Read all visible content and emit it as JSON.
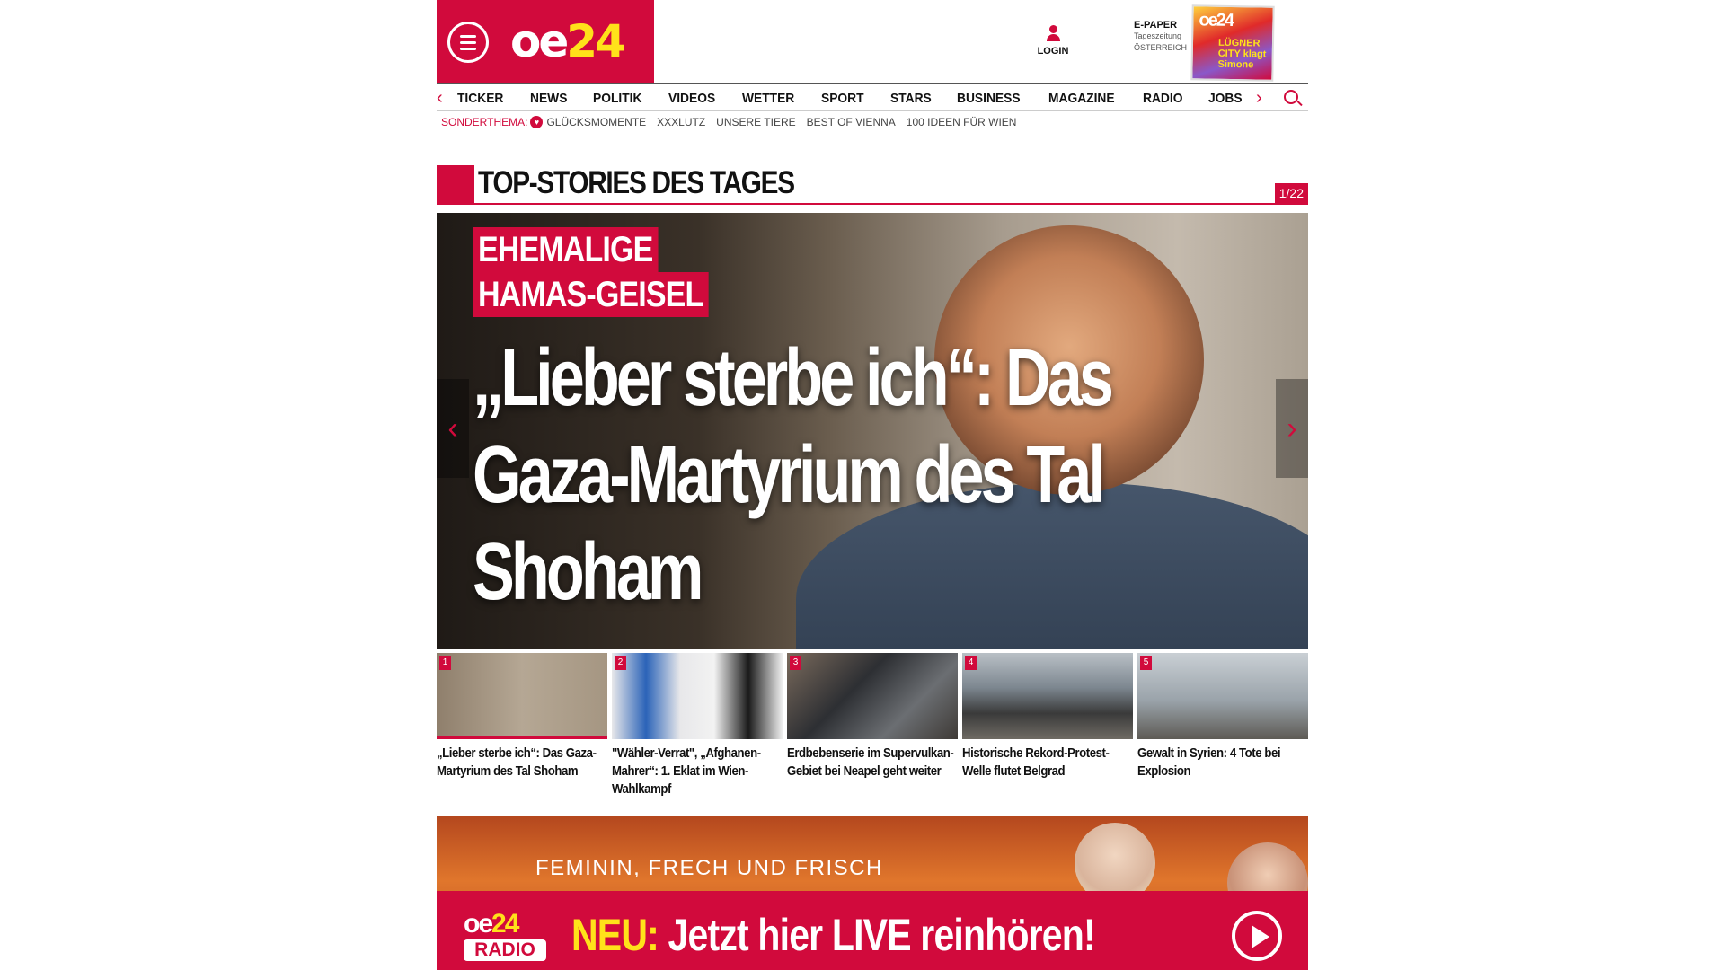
{
  "header": {
    "logo": {
      "part1": "oe",
      "part2": "24"
    },
    "login_label": "LOGIN",
    "epaper": {
      "title": "E-PAPER",
      "line2": "Tageszeitung",
      "line3": "ÖSTERREICH",
      "cover_logo": "oe24",
      "cover_text": "LÜGNER CITY klagt Simone"
    }
  },
  "nav": {
    "items": [
      "TICKER",
      "NEWS",
      "POLITIK",
      "VIDEOS",
      "WETTER",
      "SPORT",
      "STARS",
      "BUSINESS",
      "MAGAZINE",
      "RADIO",
      "JOBS"
    ]
  },
  "subnav": {
    "label": "SONDERTHEMA:",
    "items": [
      "GLÜCKSMOMENTE",
      "XXXLUTZ",
      "UNSERE TIERE",
      "BEST OF VIENNA",
      "100 IDEEN FÜR WIEN"
    ]
  },
  "top_stories": {
    "title": "TOP-STORIES DES TAGES",
    "counter": "1/22"
  },
  "hero": {
    "kicker_line1": "EHEMALIGE",
    "kicker_line2": "HAMAS-GEISEL",
    "headline": "„Lieber sterbe ich“: Das Gaza-Martyrium des Tal Shoham"
  },
  "thumbs": [
    {
      "num": "1",
      "caption": "„Lieber sterbe ich“: Das Gaza-Martyrium des Tal Shoham"
    },
    {
      "num": "2",
      "caption": "\"Wähler-Verrat\", „Afghanen-Mahrer“: 1. Eklat im Wien-Wahlkampf"
    },
    {
      "num": "3",
      "caption": "Erdbebenserie im Supervulkan-Gebiet bei Neapel geht weiter"
    },
    {
      "num": "4",
      "caption": "Historische Rekord-Protest-Welle flutet Belgrad"
    },
    {
      "num": "5",
      "caption": "Gewalt in Syrien: 4 Tote bei Explosion"
    }
  ],
  "radio": {
    "tagline": "FEMININ, FRECH UND FRISCH",
    "logo_part1": "oe",
    "logo_part2": "24",
    "logo_radio": "RADIO",
    "cta_neu": "NEU:",
    "cta_text": "Jetzt hier LIVE reinhören!"
  },
  "colors": {
    "brand_red": "#d10a3c",
    "brand_yellow": "#ffe21a"
  }
}
